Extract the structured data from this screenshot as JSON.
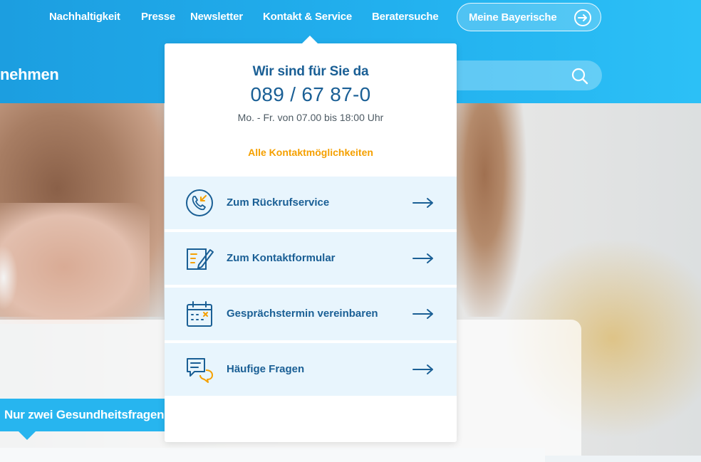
{
  "topnav": {
    "items": [
      "Nachhaltigkeit",
      "Presse",
      "Newsletter",
      "Kontakt & Service",
      "Beratersuche"
    ],
    "account_button": "Meine Bayerische"
  },
  "header": {
    "brand_fragment": "nehmen"
  },
  "contact_dropdown": {
    "title": "Wir sind für Sie da",
    "phone": "089 / 67 87-0",
    "hours": "Mo. - Fr. von 07.00 bis 18:00 Uhr",
    "all_contacts_link": "Alle Kontaktmöglichkeiten",
    "items": [
      {
        "label": "Zum Rückrufservice",
        "icon": "callback-phone-icon"
      },
      {
        "label": "Zum Kontaktformular",
        "icon": "contact-form-icon"
      },
      {
        "label": "Gesprächstermin vereinbaren",
        "icon": "calendar-icon"
      },
      {
        "label": "Häufige Fragen",
        "icon": "faq-chat-icon"
      }
    ]
  },
  "promo": {
    "tag": "Nur zwei Gesundheitsfragen"
  },
  "colors": {
    "header_blue": "#22b0ee",
    "text_blue": "#1a5f95",
    "link_orange": "#f5a000",
    "item_bg": "#e8f5fd"
  }
}
